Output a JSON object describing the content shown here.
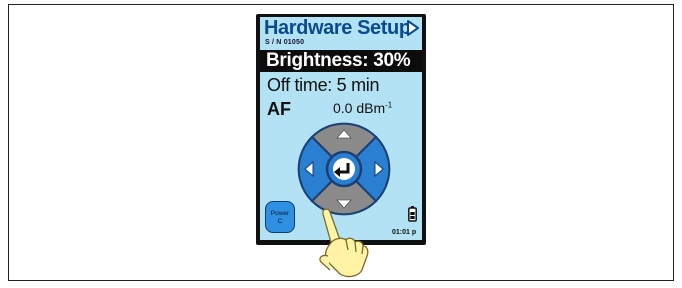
{
  "device": {
    "title": "Hardware Setup",
    "serial": "S / N  01050",
    "brightness_label": "Brightness: 30%",
    "off_time_label": "Off time: 5 min",
    "af_label": "AF",
    "af_value": "0.0 dBm",
    "af_unit_sup": "-1",
    "power_line1": "Power",
    "power_line2": "C",
    "clock": "01:01 p"
  },
  "icons": {
    "nav": "triangle-right-icon",
    "pad_up": "arrow-up-icon",
    "pad_down": "arrow-down-icon",
    "pad_left": "arrow-left-icon",
    "pad_right": "arrow-right-icon",
    "pad_center": "enter-icon",
    "battery": "battery-icon",
    "hand": "pointing-hand-icon"
  },
  "colors": {
    "screen_bg": "#b3e2f4",
    "title": "#0a4b8f",
    "selected_row_bg": "#0c0c0c",
    "pad_blue": "#2a7fd0",
    "pad_gray": "#8a8a8a"
  }
}
